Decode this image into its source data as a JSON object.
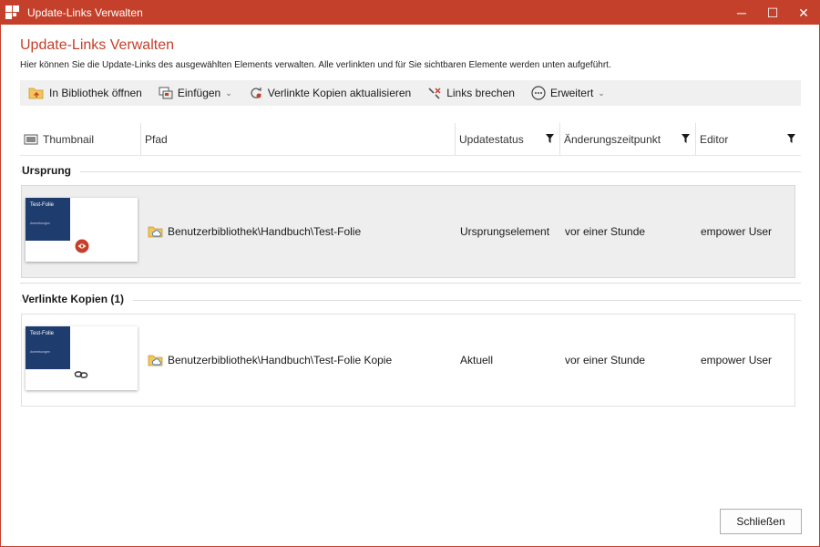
{
  "window": {
    "title": "Update-Links Verwalten",
    "accent_color": "#c4402a",
    "controls": {
      "minimize": "─",
      "maximize": "☐",
      "close": "✕"
    }
  },
  "header": {
    "title": "Update-Links Verwalten",
    "description": "Hier können Sie die Update-Links des ausgewählten Elements verwalten. Alle verlinkten und für Sie sichtbaren Elemente werden unten aufgeführt."
  },
  "toolbar": {
    "open_library": "In Bibliothek öffnen",
    "insert": "Einfügen",
    "update_copies": "Verlinkte Kopien aktualisieren",
    "break_links": "Links brechen",
    "advanced": "Erweitert"
  },
  "columns": {
    "thumbnail": "Thumbnail",
    "path": "Pfad",
    "status": "Updatestatus",
    "changed": "Änderungszeitpunkt",
    "editor": "Editor"
  },
  "groups": {
    "origin": {
      "label": "Ursprung",
      "row": {
        "thumb_title": "Test-Folie",
        "thumb_sub": "Anmerkungen",
        "path": "Benutzerbibliothek\\Handbuch\\Test-Folie",
        "status": "Ursprungselement",
        "changed": "vor einer Stunde",
        "editor": "empower User"
      }
    },
    "copies": {
      "label": "Verlinkte Kopien (1)",
      "row": {
        "thumb_title": "Test-Folie",
        "thumb_sub": "Anmerkungen",
        "path": "Benutzerbibliothek\\Handbuch\\Test-Folie Kopie",
        "status": "Aktuell",
        "changed": "vor einer Stunde",
        "editor": "empower User"
      }
    }
  },
  "footer": {
    "close_label": "Schließen"
  },
  "icons": {
    "app": "app-logo-icon",
    "open_library": "folder-open-icon",
    "insert": "insert-slide-icon",
    "update": "refresh-link-icon",
    "break": "broken-link-icon",
    "advanced": "more-icon",
    "thumbnail_col": "image-icon",
    "filter": "filter-icon",
    "path": "cloud-folder-icon",
    "link": "link-icon"
  }
}
